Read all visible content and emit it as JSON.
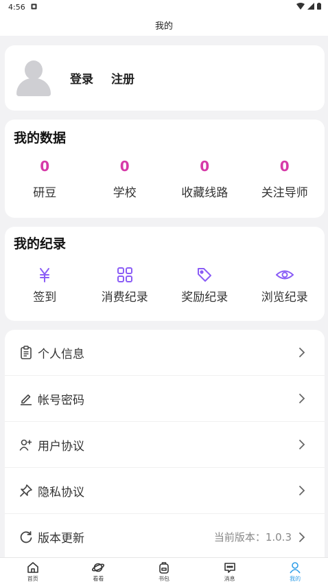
{
  "status_bar": {
    "time": "4:56"
  },
  "header": {
    "title": "我的"
  },
  "profile": {
    "login_label": "登录",
    "register_label": "注册"
  },
  "my_data": {
    "title": "我的数据",
    "stats": [
      {
        "value": "0",
        "label": "研豆"
      },
      {
        "value": "0",
        "label": "学校"
      },
      {
        "value": "0",
        "label": "收藏线路"
      },
      {
        "value": "0",
        "label": "关注导师"
      }
    ]
  },
  "my_records": {
    "title": "我的纪录",
    "items": [
      {
        "label": "签到",
        "icon": "yen-icon"
      },
      {
        "label": "消费纪录",
        "icon": "grid-icon"
      },
      {
        "label": "奖励纪录",
        "icon": "tag-icon"
      },
      {
        "label": "浏览纪录",
        "icon": "eye-icon"
      }
    ]
  },
  "menu": [
    {
      "label": "个人信息",
      "icon": "clipboard-icon"
    },
    {
      "label": "帐号密码",
      "icon": "edit-icon"
    },
    {
      "label": "用户协议",
      "icon": "user-plus-icon"
    },
    {
      "label": "隐私协议",
      "icon": "pin-icon"
    },
    {
      "label": "版本更新",
      "icon": "refresh-icon",
      "value": "当前版本：1.0.3"
    }
  ],
  "bottom_nav": [
    {
      "label": "首页",
      "icon": "home-icon"
    },
    {
      "label": "看看",
      "icon": "planet-icon"
    },
    {
      "label": "书包",
      "icon": "backpack-icon"
    },
    {
      "label": "消息",
      "icon": "message-icon"
    },
    {
      "label": "我的",
      "icon": "person-icon"
    }
  ],
  "colors": {
    "accent_pink": "#d63aa8",
    "accent_purple": "#8a5cf6",
    "active_tab": "#2f9ee8"
  }
}
